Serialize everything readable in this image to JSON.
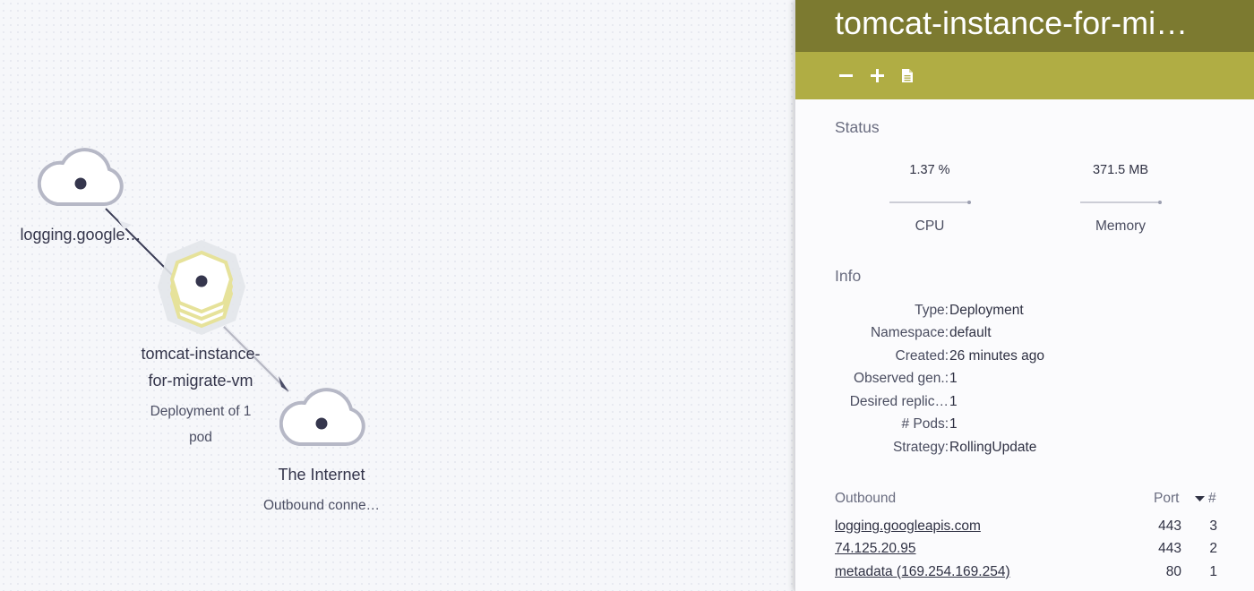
{
  "graph": {
    "nodes": [
      {
        "id": "logging",
        "label": "logging.google…",
        "sub": ""
      },
      {
        "id": "tomcat",
        "label_line1": "tomcat-instance-",
        "label_line2": "for-migrate-vm",
        "sub_line1": "Deployment of 1",
        "sub_line2": "pod"
      },
      {
        "id": "internet",
        "label": "The Internet",
        "sub": "Outbound conne…"
      }
    ]
  },
  "panel": {
    "title": "tomcat-instance-for-mi…",
    "toolbar": {
      "minus_icon": "minus-icon",
      "plus_icon": "plus-icon",
      "doc_icon": "document-icon"
    },
    "status": {
      "title": "Status",
      "cpu_value": "1.37 %",
      "cpu_label": "CPU",
      "memory_value": "371.5 MB",
      "memory_label": "Memory"
    },
    "info": {
      "title": "Info",
      "rows": [
        {
          "key": "Type:",
          "value": "Deployment"
        },
        {
          "key": "Namespace:",
          "value": "default"
        },
        {
          "key": "Created:",
          "value": "26 minutes ago"
        },
        {
          "key": "Observed gen.:",
          "value": "1"
        },
        {
          "key": "Desired replic…",
          "value": "1"
        },
        {
          "key": "# Pods:",
          "value": "1"
        },
        {
          "key": "Strategy:",
          "value": "RollingUpdate"
        }
      ]
    },
    "outbound": {
      "title": "Outbound",
      "port_header": "Port",
      "count_header": "#",
      "rows": [
        {
          "host": "logging.googleapis.com",
          "port": "443",
          "count": "3"
        },
        {
          "host": "74.125.20.95",
          "port": "443",
          "count": "2"
        },
        {
          "host": "metadata (169.254.169.254)",
          "port": "80",
          "count": "1"
        }
      ]
    }
  },
  "colors": {
    "header_bg": "#7c7a30",
    "toolbar_bg": "#b0ad44",
    "highlight": "#e6e29a",
    "node_outline": "#b6b8c6",
    "node_dot": "#35364d"
  }
}
